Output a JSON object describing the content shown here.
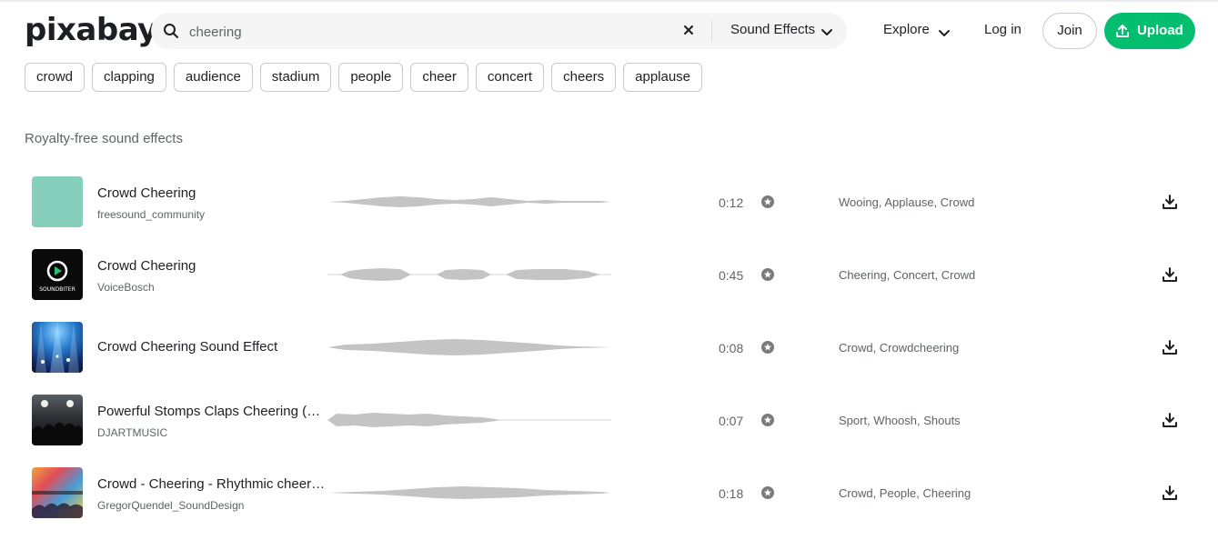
{
  "header": {
    "logo": "pixabay",
    "search_value": "cheering",
    "media_type": "Sound Effects",
    "explore": "Explore",
    "login": "Log in",
    "join": "Join",
    "upload": "Upload",
    "accent_color": "#02be6e"
  },
  "tags": [
    "crowd",
    "clapping",
    "audience",
    "stadium",
    "people",
    "cheer",
    "concert",
    "cheers",
    "applause"
  ],
  "section_title": "Royalty-free sound effects",
  "thumb_text": {
    "soundbiter": "SOUNDBITER"
  },
  "rows": [
    {
      "title": "Crowd Cheering",
      "author": "freesound_community",
      "duration": "0:12",
      "tags": "Wooing, Applause, Crowd"
    },
    {
      "title": "Crowd Cheering",
      "author": "VoiceBosch",
      "duration": "0:45",
      "tags": "Cheering, Concert, Crowd"
    },
    {
      "title": "Crowd Cheering Sound Effect",
      "author": "",
      "duration": "0:08",
      "tags": "Crowd, Crowdcheering"
    },
    {
      "title": "Powerful Stomps Claps Cheering (…",
      "author": "DJARTMUSIC",
      "duration": "0:07",
      "tags": "Sport, Whoosh, Shouts"
    },
    {
      "title": "Crowd - Cheering - Rhythmic cheer…",
      "author": "GregorQuendel_SoundDesign",
      "duration": "0:18",
      "tags": "Crowd, People, Cheering"
    }
  ]
}
